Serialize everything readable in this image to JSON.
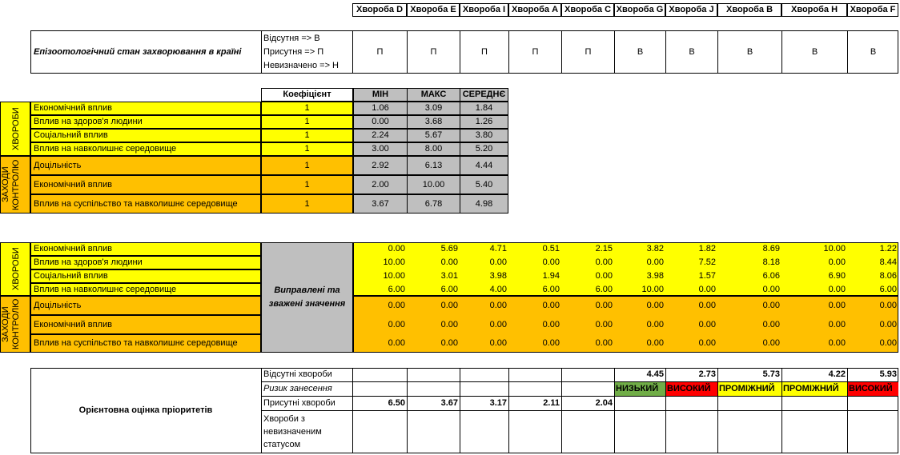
{
  "columns": [
    "Хвороба D",
    "Хвороба E",
    "Хвороба I",
    "Хвороба A",
    "Хвороба C",
    "Хвороба G",
    "Хвороба J",
    "Хвороба B",
    "Хвороба H",
    "Хвороба F"
  ],
  "status": {
    "title": "Епізоотологічний стан захворювання в країні",
    "legend": [
      "Відсутня => В",
      "Присутня => П",
      "Невизначено => Н"
    ],
    "values": [
      "П",
      "П",
      "П",
      "П",
      "П",
      "В",
      "В",
      "В",
      "В",
      "В"
    ]
  },
  "coef_table": {
    "headers": {
      "coef": "Коефіцієнт",
      "min": "МІН",
      "max": "МАКС",
      "avg": "СЕРЕДНЄ"
    },
    "group1_label": "ХВОРОБИ",
    "group2_label": "ЗАХОДИ КОНТРОЛЮ",
    "rows": [
      {
        "label": "Економічний вплив",
        "coef": "1",
        "min": "1.06",
        "max": "3.09",
        "avg": "1.84"
      },
      {
        "label": "Вплив на здоров'я людини",
        "coef": "1",
        "min": "0.00",
        "max": "3.68",
        "avg": "1.26"
      },
      {
        "label": "Соціальний вплив",
        "coef": "1",
        "min": "2.24",
        "max": "5.67",
        "avg": "3.80"
      },
      {
        "label": "Вплив на навколишнє середовище",
        "coef": "1",
        "min": "3.00",
        "max": "8.00",
        "avg": "5.20"
      },
      {
        "label": "Доцільність",
        "coef": "1",
        "min": "2.92",
        "max": "6.13",
        "avg": "4.44"
      },
      {
        "label": "Економічний вплив",
        "coef": "1",
        "min": "2.00",
        "max": "10.00",
        "avg": "5.40"
      },
      {
        "label": "Вплив на суспільство та навколишнє середовище",
        "coef": "1",
        "min": "3.67",
        "max": "6.78",
        "avg": "4.98"
      }
    ]
  },
  "weighted": {
    "center_label": "Виправлені та зважені значення",
    "group1_label": "ХВОРОБИ",
    "group2_label": "ЗАХОДИ КОНТРОЛЮ",
    "rows": [
      {
        "label": "Економічний вплив",
        "values": [
          "0.00",
          "5.69",
          "4.71",
          "0.51",
          "2.15",
          "3.82",
          "1.82",
          "8.69",
          "10.00",
          "1.22"
        ]
      },
      {
        "label": "Вплив на здоров'я людини",
        "values": [
          "10.00",
          "0.00",
          "0.00",
          "0.00",
          "0.00",
          "0.00",
          "7.52",
          "8.18",
          "0.00",
          "8.44"
        ]
      },
      {
        "label": "Соціальний вплив",
        "values": [
          "10.00",
          "3.01",
          "3.98",
          "1.94",
          "0.00",
          "3.98",
          "1.57",
          "6.06",
          "6.90",
          "8.06"
        ]
      },
      {
        "label": "Вплив на навколишнє середовище",
        "values": [
          "6.00",
          "6.00",
          "4.00",
          "6.00",
          "6.00",
          "10.00",
          "0.00",
          "0.00",
          "0.00",
          "6.00"
        ]
      },
      {
        "label": "Доцільність",
        "values": [
          "0.00",
          "0.00",
          "0.00",
          "0.00",
          "0.00",
          "0.00",
          "0.00",
          "0.00",
          "0.00",
          "0.00"
        ]
      },
      {
        "label": "Економічний вплив",
        "values": [
          "0.00",
          "0.00",
          "0.00",
          "0.00",
          "0.00",
          "0.00",
          "0.00",
          "0.00",
          "0.00",
          "0.00"
        ]
      },
      {
        "label": "Вплив на суспільство та навколишнє середовище",
        "values": [
          "0.00",
          "0.00",
          "0.00",
          "0.00",
          "0.00",
          "0.00",
          "0.00",
          "0.00",
          "0.00",
          "0.00"
        ]
      }
    ]
  },
  "priority": {
    "title": "Орієнтовна оцінка пріоритетів",
    "absent_label": "Відсутні хвороби",
    "risk_label": "Ризик занесення",
    "present_label": "Присутні хвороби",
    "undetermined_label": "Хвороби з невизначеним статусом",
    "absent_values": [
      "",
      "",
      "",
      "",
      "",
      "4.45",
      "2.73",
      "5.73",
      "4.22",
      "5.93"
    ],
    "risk_values": [
      "",
      "",
      "",
      "",
      "",
      "НИЗЬКИЙ",
      "ВИСОКИЙ",
      "ПРОМІЖНИЙ",
      "ПРОМІЖНИЙ",
      "ВИСОКИЙ"
    ],
    "risk_colors": [
      "",
      "",
      "",
      "",
      "",
      "#70ad47",
      "#ff0000",
      "#ffff00",
      "#ffff00",
      "#ff0000"
    ],
    "present_values": [
      "6.50",
      "3.67",
      "3.17",
      "2.11",
      "2.04",
      "",
      "",
      "",
      "",
      ""
    ]
  }
}
